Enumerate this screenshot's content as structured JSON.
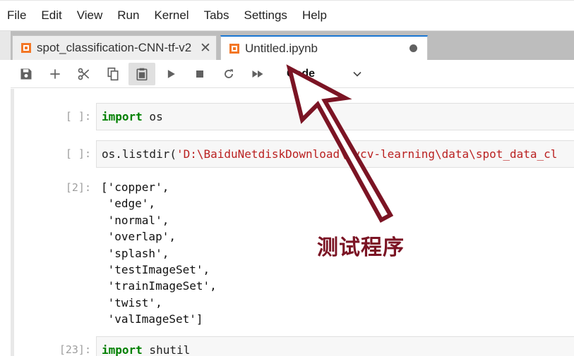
{
  "menu": [
    "File",
    "Edit",
    "View",
    "Run",
    "Kernel",
    "Tabs",
    "Settings",
    "Help"
  ],
  "tabs": [
    {
      "label": "spot_classification-CNN-tf-v2",
      "close": "✕",
      "active": false
    },
    {
      "label": "Untitled.ipynb",
      "active": true
    }
  ],
  "toolbar": {
    "icons": [
      "save-icon",
      "add-icon",
      "cut-icon",
      "copy-icon",
      "paste-icon",
      "run-icon",
      "stop-icon",
      "restart-icon",
      "fast-forward-icon"
    ],
    "cell_type": "Code"
  },
  "cells": [
    {
      "prompt": "[ ]:",
      "code": [
        {
          "t": "kw",
          "v": "import"
        },
        {
          "t": "plain",
          "v": " os"
        }
      ]
    },
    {
      "prompt": "[ ]:",
      "code": [
        {
          "t": "plain",
          "v": "os.listdir("
        },
        {
          "t": "str",
          "v": "'D:\\BaiduNetdiskDownload\\pycv-learning\\data\\spot_data_cl"
        }
      ]
    },
    {
      "prompt": "[2]:",
      "output": "['copper',\n 'edge',\n 'normal',\n 'overlap',\n 'splash',\n 'testImageSet',\n 'trainImageSet',\n 'twist',\n 'valImageSet']"
    },
    {
      "prompt": "[23]:",
      "code": [
        {
          "t": "kw",
          "v": "import"
        },
        {
          "t": "plain",
          "v": " shutil"
        }
      ]
    }
  ],
  "annotation": {
    "text": "测试程序",
    "color": "#7b1424"
  }
}
